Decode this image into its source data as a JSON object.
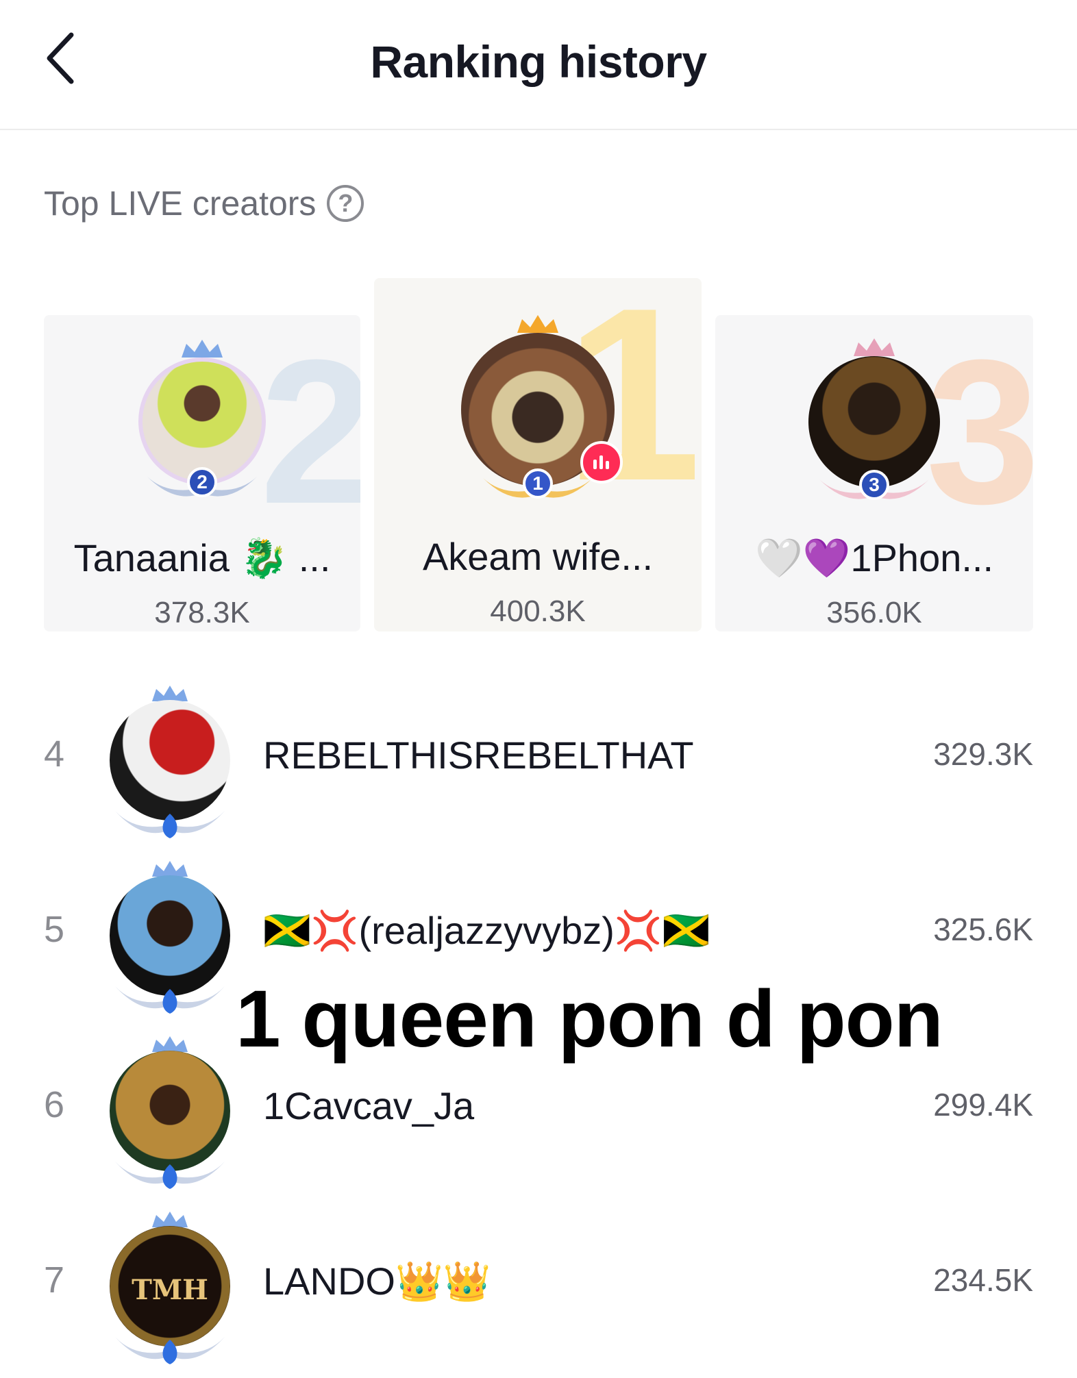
{
  "header": {
    "title": "Ranking history",
    "back_icon": "chevron-left-icon"
  },
  "section": {
    "label": "Top LIVE creators",
    "help_icon": "?"
  },
  "podium": [
    {
      "rank": "2",
      "name": "Tanaania 🐉 ...",
      "score": "378.3K"
    },
    {
      "rank": "1",
      "name": "Akeam wife...",
      "score": "400.3K",
      "live": true
    },
    {
      "rank": "3",
      "name": "🤍💜1Phon...",
      "score": "356.0K"
    }
  ],
  "list": [
    {
      "rank": "4",
      "name": "REBELTHISREBELTHAT",
      "score": "329.3K"
    },
    {
      "rank": "5",
      "name": "🇯🇲💢(realjazzyvybz)💢🇯🇲",
      "score": "325.6K"
    },
    {
      "rank": "6",
      "name": "1Cavcav_Ja",
      "score": "299.4K"
    },
    {
      "rank": "7",
      "name": "LANDO👑👑",
      "score": "234.5K"
    }
  ],
  "avatar_labels": {
    "tmh": "TMH"
  },
  "overlay": {
    "caption": "1 queen pon d pon"
  },
  "colors": {
    "live_badge": "#fe2c55",
    "rank_badge": "#2b4fb8",
    "gold_number": "#fbe6a8",
    "silver_number": "#dde6ef",
    "bronze_number": "#f8dcc9"
  }
}
